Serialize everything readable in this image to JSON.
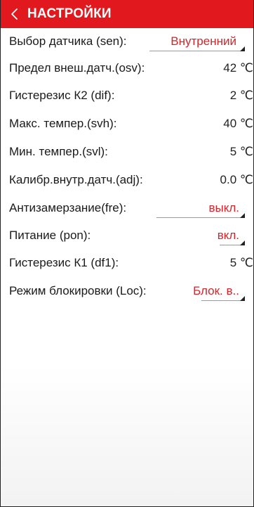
{
  "header": {
    "title": "НАСТРОЙКИ",
    "color": "#e2181f"
  },
  "settings": {
    "sensor": {
      "label": "Выбор датчика (sen):",
      "value": "Внутренний"
    },
    "osv": {
      "label": "Предел внеш.датч.(osv):",
      "value": "42 ℃"
    },
    "dif": {
      "label": "Гистерезис К2 (dif):",
      "value": "2 ℃"
    },
    "svh": {
      "label": "Макс. темпер.(svh):",
      "value": "40 ℃"
    },
    "svl": {
      "label": "Мин. темпер.(svl):",
      "value": "5 ℃"
    },
    "adj": {
      "label": "Калибр.внутр.датч.(adj):",
      "value": "0.0 ℃"
    },
    "fre": {
      "label": "Антизамерзание(fre):",
      "value": "выкл."
    },
    "pon": {
      "label": "Питание (pon):",
      "value": "вкл."
    },
    "df1": {
      "label": "Гистерезис К1 (df1):",
      "value": "5 ℃"
    },
    "loc": {
      "label": "Режим блокировки (Loc):",
      "value": "Блок. в.."
    }
  }
}
